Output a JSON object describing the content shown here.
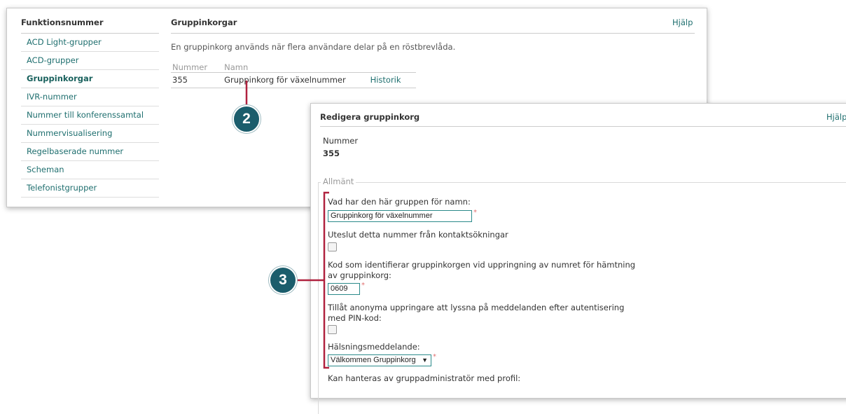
{
  "panel1": {
    "nav_title": "Funktionsnummer",
    "nav_items": [
      {
        "label": "ACD Light-grupper"
      },
      {
        "label": "ACD-grupper"
      },
      {
        "label": "Gruppinkorgar"
      },
      {
        "label": "IVR-nummer"
      },
      {
        "label": "Nummer till konferenssamtal"
      },
      {
        "label": "Nummervisualisering"
      },
      {
        "label": "Regelbaserade nummer"
      },
      {
        "label": "Scheman"
      },
      {
        "label": "Telefonistgrupper"
      }
    ],
    "active_index": 2,
    "title": "Gruppinkorgar",
    "help": "Hjälp",
    "description": "En gruppinkorg används när flera användare delar på en röstbrevlåda.",
    "table": {
      "headers": [
        "Nummer",
        "Namn"
      ],
      "rows": [
        {
          "number": "355",
          "name": "Gruppinkorg för växelnummer",
          "link": "Historik"
        }
      ]
    }
  },
  "panel2": {
    "title": "Redigera gruppinkorg",
    "help": "Hjälp",
    "number_label": "Nummer",
    "number_value": "355",
    "section_legend": "Allmänt",
    "name_label": "Vad har den här gruppen för namn:",
    "name_value": "Gruppinkorg för växelnummer",
    "exclude_label": "Uteslut detta nummer från kontaktsökningar",
    "code_label_line1": "Kod som identifierar gruppinkorgen vid uppringning av numret för hämtning",
    "code_label_line2": "av gruppinkorg:",
    "code_value": "0609",
    "anon_label_line1": "Tillåt anonyma uppringare att lyssna på meddelanden efter autentisering",
    "anon_label_line2": "med PIN-kod:",
    "greeting_label": "Hälsningsmeddelande:",
    "greeting_value": "Välkommen Gruppinkorg",
    "admin_label": "Kan hanteras av gruppadministratör med profil:",
    "required_mark": "*"
  },
  "callouts": [
    "2",
    "3"
  ],
  "colors": {
    "callout": "#1b5d6c",
    "bracket": "#b0223f",
    "link": "#1f6f6f",
    "input_border": "#2b8a8a"
  }
}
